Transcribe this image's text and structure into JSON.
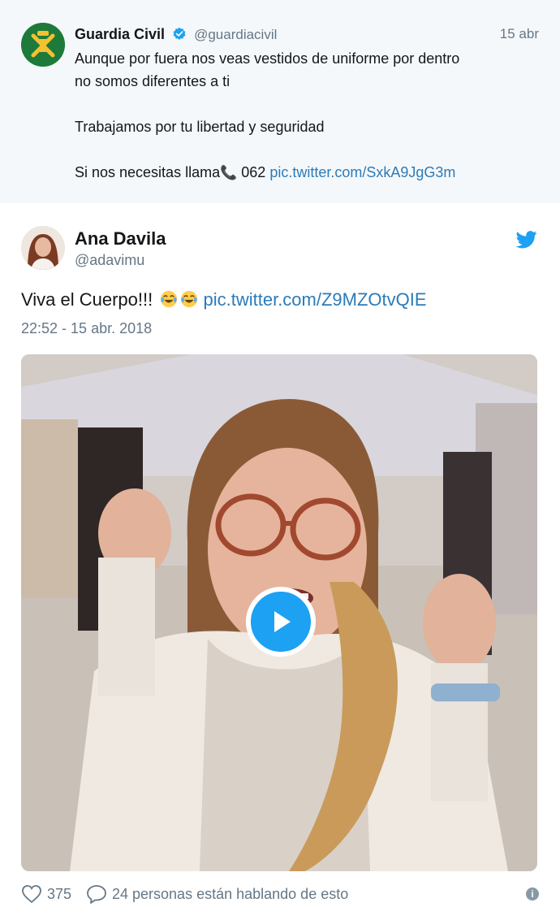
{
  "quoted_tweet": {
    "display_name": "Guardia Civil",
    "handle": "@guardiacivil",
    "date": "15 abr",
    "lines": [
      "Aunque por fuera nos veas vestidos de uniforme por dentro",
      "no somos diferentes a ti",
      "Trabajamos por tu libertad y seguridad"
    ],
    "call_prefix": "Si nos necesitas llama",
    "call_number": "062",
    "link": "pic.twitter.com/SxkA9JgG3m",
    "avatar_color": "#1e7a3a"
  },
  "tweet": {
    "display_name": "Ana Davila",
    "handle": "@adavimu",
    "text": "Viva el Cuerpo!!!",
    "link": "pic.twitter.com/Z9MZOtvQIE",
    "timestamp": "22:52 - 15 abr. 2018",
    "likes": "375",
    "conversation": "24 personas están hablando de esto",
    "info_icon": "i"
  },
  "colors": {
    "link": "#2b7bb9",
    "twitter_blue": "#1da1f2",
    "muted": "#657786",
    "quoted_bg": "#f5f8fa"
  }
}
